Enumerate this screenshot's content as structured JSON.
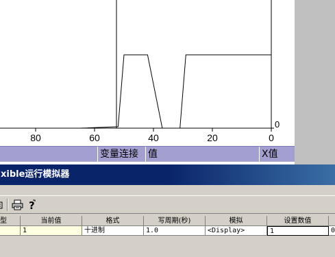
{
  "chart": {
    "x_ticks": [
      "80",
      "60",
      "40",
      "20",
      "0"
    ],
    "x_tick_values": [
      80,
      60,
      40,
      20,
      0
    ],
    "x_range": [
      96,
      0
    ],
    "y_label": "0",
    "trend": [
      {
        "x": 96,
        "y": 0
      },
      {
        "x": 65,
        "y": 0
      },
      {
        "x": 52,
        "y": 0.02
      },
      {
        "x": 50,
        "y": 1
      },
      {
        "x": 45,
        "y": 1
      },
      {
        "x": 42,
        "y": 1
      },
      {
        "x": 37,
        "y": 0
      },
      {
        "x": 34,
        "y": 0
      },
      {
        "x": 31,
        "y": 0
      },
      {
        "x": 29,
        "y": 1
      },
      {
        "x": 0,
        "y": 1
      }
    ],
    "line_color": "#000000"
  },
  "var_strip": {
    "col_connection": "变量连接",
    "col_value": "值",
    "col_x": "X值",
    "bg_color": "#a3a0d1"
  },
  "simulator": {
    "title": "xible运行模拟器",
    "toolbar": {
      "print_icon": "printer-icon",
      "help_icon": "help-icon"
    },
    "columns": [
      "型",
      "当前值",
      "格式",
      "写周期(秒)",
      "模拟",
      "设置数值"
    ],
    "row": {
      "type": "",
      "current_value": "1",
      "format": "十进制",
      "write_cycle": "1.0",
      "simulation": "<Display>",
      "set_value": "1",
      "extra": "0"
    }
  }
}
